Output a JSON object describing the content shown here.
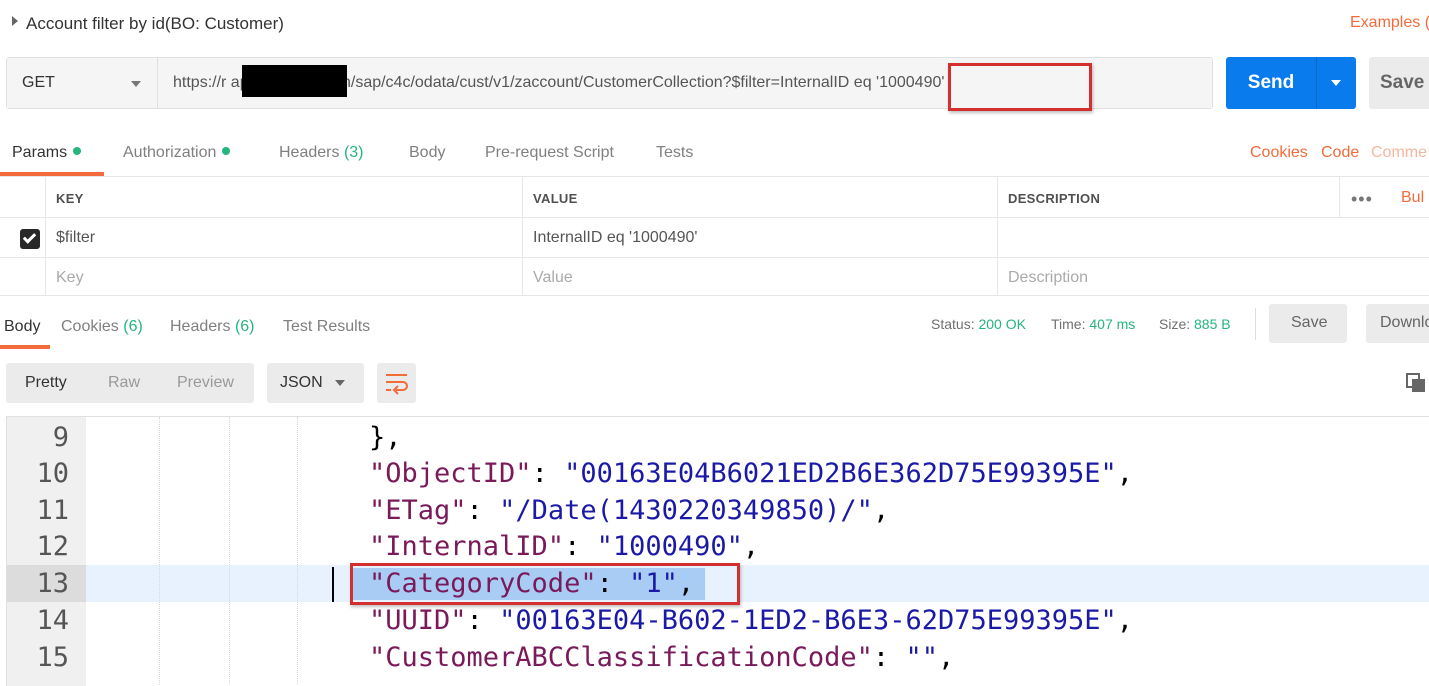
{
  "request": {
    "name": "Account filter by id(BO: Customer)",
    "examples_label": "Examples (",
    "method": "GET",
    "url": "https://r                aphybriscloud.cn/sap/c4c/odata/cust/v1/zaccount/CustomerCollection?$filter=InternalID eq '1000490'",
    "send_label": "Send",
    "save_label": "Save"
  },
  "request_tabs": {
    "params": "Params",
    "authorization": "Authorization",
    "headers": "Headers",
    "headers_count": "(3)",
    "body": "Body",
    "prerequest": "Pre-request Script",
    "tests": "Tests",
    "cookies": "Cookies",
    "code": "Code",
    "comments": "Comme"
  },
  "params_table": {
    "columns": [
      "KEY",
      "VALUE",
      "DESCRIPTION"
    ],
    "more": "•••",
    "bulk_edit": "Bul",
    "rows": [
      {
        "key": "$filter",
        "value": "InternalID eq '1000490'",
        "description": ""
      }
    ],
    "placeholders": {
      "key": "Key",
      "value": "Value",
      "description": "Description"
    }
  },
  "response_tabs": {
    "body": "Body",
    "cookies": "Cookies",
    "cookies_count": "(6)",
    "headers": "Headers",
    "headers_count": "(6)",
    "test_results": "Test Results"
  },
  "response_meta": {
    "status_label": "Status:",
    "status_value": "200 OK",
    "time_label": "Time:",
    "time_value": "407 ms",
    "size_label": "Size:",
    "size_value": "885 B",
    "save_label": "Save",
    "download_label": "Downlo"
  },
  "body_toolbar": {
    "views": [
      "Pretty",
      "Raw",
      "Preview"
    ],
    "format": "JSON"
  },
  "code_lines": [
    {
      "n": "9",
      "text": "},"
    },
    {
      "n": "10",
      "key": "\"ObjectID\"",
      "val": "\"00163E04B6021ED2B6E362D75E99395E\""
    },
    {
      "n": "11",
      "key": "\"ETag\"",
      "val": "\"/Date(1430220349850)/\""
    },
    {
      "n": "12",
      "key": "\"InternalID\"",
      "val": "\"1000490\""
    },
    {
      "n": "13",
      "key": "\"CategoryCode\"",
      "val": "\"1\""
    },
    {
      "n": "14",
      "key": "\"UUID\"",
      "val": "\"00163E04-B602-1ED2-B6E3-62D75E99395E\""
    },
    {
      "n": "15",
      "key": "\"CustomerABCClassificationCode\"",
      "val": "\"\""
    }
  ],
  "colors": {
    "accent": "#f26b3a",
    "send": "#097bed",
    "success": "#26b47f",
    "json_key": "#7a1a5a",
    "json_string": "#1a1aa6",
    "annotation_box": "#d32f2f"
  }
}
